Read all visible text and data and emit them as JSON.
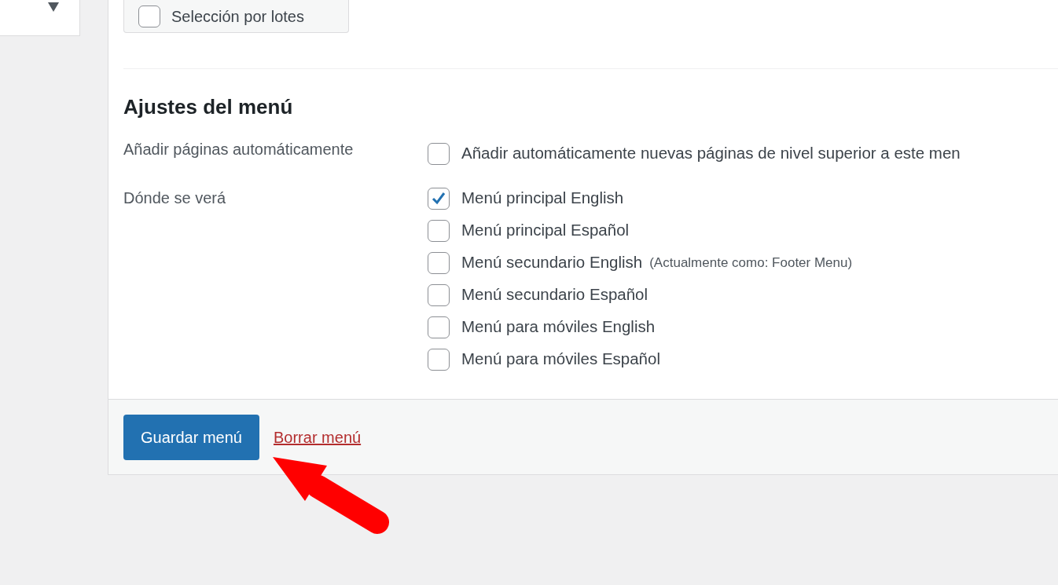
{
  "batch_select": {
    "label": "Selección por lotes",
    "checked": false
  },
  "menu_settings": {
    "heading": "Ajustes del menú",
    "auto_add": {
      "label": "Añadir páginas automáticamente",
      "option": {
        "label": "Añadir automáticamente nuevas páginas de nivel superior a este men",
        "checked": false
      }
    },
    "locations": {
      "label": "Dónde se verá",
      "items": [
        {
          "label": "Menú principal English",
          "checked": true
        },
        {
          "label": "Menú principal Español",
          "checked": false
        },
        {
          "label": "Menú secundario English",
          "note": "(Actualmente como: Footer Menu)",
          "checked": false
        },
        {
          "label": "Menú secundario Español",
          "checked": false
        },
        {
          "label": "Menú para móviles English",
          "checked": false
        },
        {
          "label": "Menú para móviles Español",
          "checked": false
        }
      ]
    }
  },
  "footer": {
    "save_button": "Guardar menú",
    "delete_link": "Borrar menú"
  }
}
